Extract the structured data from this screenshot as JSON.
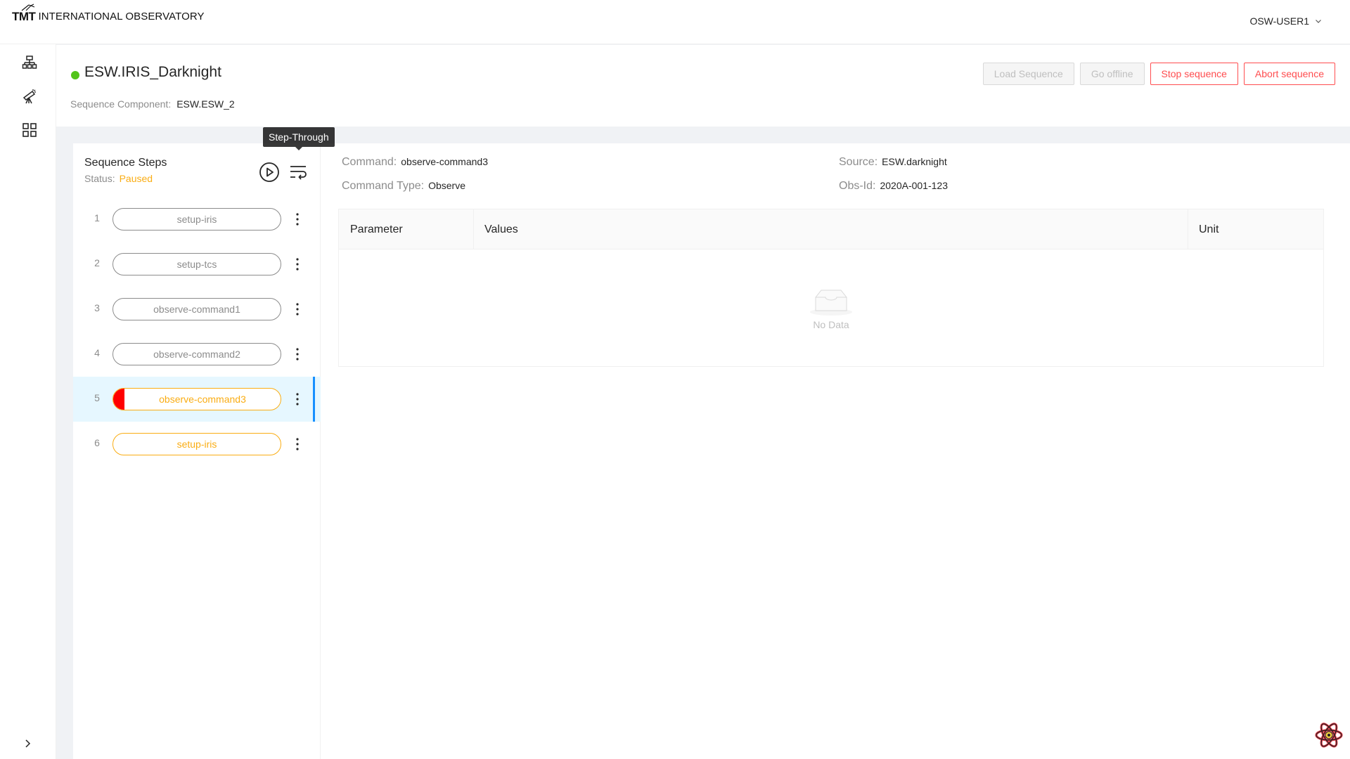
{
  "header": {
    "logo_mark": "TMT",
    "logo_text": "INTERNATIONAL OBSERVATORY",
    "user": "OSW-USER1"
  },
  "nav": {
    "items": [
      {
        "icon": "hierarchy-icon"
      },
      {
        "icon": "telescope-icon"
      },
      {
        "icon": "grid-icon"
      }
    ],
    "collapse_icon": "chevron-right-icon"
  },
  "page": {
    "title": "ESW.IRIS_Darknight",
    "status_color": "#52c41a",
    "seq_component_label": "Sequence Component:",
    "seq_component_value": "ESW.ESW_2",
    "buttons": {
      "load": "Load Sequence",
      "offline": "Go offline",
      "stop": "Stop sequence",
      "abort": "Abort sequence"
    }
  },
  "steps": {
    "title": "Sequence Steps",
    "status_label": "Status:",
    "status_value": "Paused",
    "tooltip": "Step-Through",
    "items": [
      {
        "num": "1",
        "name": "setup-iris"
      },
      {
        "num": "2",
        "name": "setup-tcs"
      },
      {
        "num": "3",
        "name": "observe-command1"
      },
      {
        "num": "4",
        "name": "observe-command2"
      },
      {
        "num": "5",
        "name": "observe-command3"
      },
      {
        "num": "6",
        "name": "setup-iris"
      }
    ]
  },
  "details": {
    "command_label": "Command:",
    "command_value": "observe-command3",
    "type_label": "Command Type:",
    "type_value": "Observe",
    "source_label": "Source:",
    "source_value": "ESW.darknight",
    "obsid_label": "Obs-Id:",
    "obsid_value": "2020A-001-123",
    "columns": [
      "Parameter",
      "Values",
      "Unit"
    ],
    "empty_text": "No Data"
  },
  "colors": {
    "accent": "#1890ff",
    "warning": "#faad14",
    "danger": "#ff4d4f",
    "breakpoint": "#ff0000"
  }
}
